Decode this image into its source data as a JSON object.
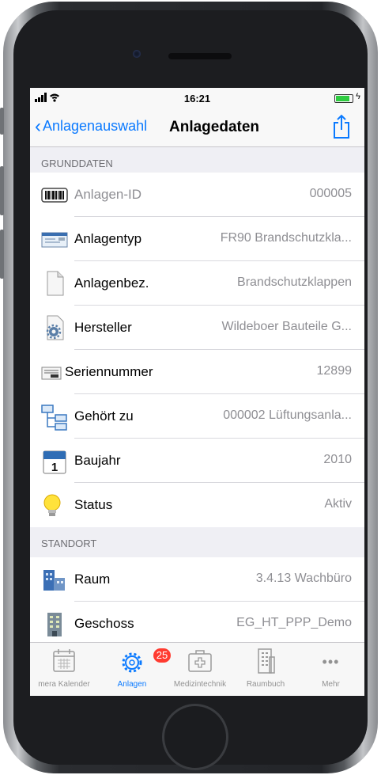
{
  "status_bar": {
    "signal": "‥ ‥ıll",
    "time": "16:21"
  },
  "navbar": {
    "back_label": "Anlagenauswahl",
    "title": "Anlagedaten"
  },
  "sections": {
    "grunddaten": "GRUNDDATEN",
    "standort": "STANDORT"
  },
  "grunddaten": [
    {
      "label": "Anlagen-ID",
      "value": "000005",
      "icon": "barcode-icon"
    },
    {
      "label": "Anlagentyp",
      "value": "FR90 Brandschutzkla...",
      "icon": "window-icon"
    },
    {
      "label": "Anlagenbez.",
      "value": "Brandschutzklappen",
      "icon": "document-icon"
    },
    {
      "label": "Hersteller",
      "value": "Wildeboer Bauteile G...",
      "icon": "gear-document-icon"
    },
    {
      "label": "Seriennummer",
      "value": "12899",
      "icon": "serial-card-icon"
    },
    {
      "label": "Gehört zu",
      "value": "000002 Lüftungsanla...",
      "icon": "hierarchy-icon"
    },
    {
      "label": "Baujahr",
      "value": "2010",
      "icon": "calendar-icon"
    },
    {
      "label": "Status",
      "value": "Aktiv",
      "icon": "lightbulb-icon"
    }
  ],
  "standort": [
    {
      "label": "Raum",
      "value": "3.4.13 Wachbüro",
      "icon": "building-icon"
    },
    {
      "label": "Geschoss",
      "value": "EG_HT_PPP_Demo",
      "icon": "office-tower-icon"
    }
  ],
  "tabs": [
    {
      "label": "mera Kalender",
      "icon": "calendar-tab-icon"
    },
    {
      "label": "Anlagen",
      "icon": "gears-tab-icon",
      "badge": "25",
      "active": true
    },
    {
      "label": "Medizintechnik",
      "icon": "medical-case-icon"
    },
    {
      "label": "Raumbuch",
      "icon": "building-tab-icon"
    },
    {
      "label": "Mehr",
      "icon": "more-icon"
    }
  ],
  "colors": {
    "accent": "#0b7aff",
    "badge": "#ff3b30",
    "battery": "#2ecc40"
  }
}
